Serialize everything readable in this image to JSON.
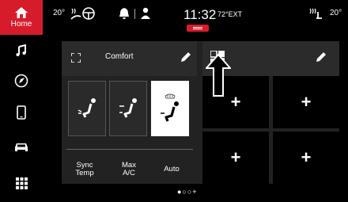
{
  "nav": {
    "home_label": "Home",
    "items": [
      "music-icon",
      "compass-icon",
      "phone-icon",
      "car-icon",
      "apps-grid-icon"
    ]
  },
  "status": {
    "left_temp": "20°",
    "right_temp": "20°",
    "clock": "11:32",
    "ext_temp": "72°EXT"
  },
  "climate": {
    "preset": "Comfort",
    "controls": [
      "Sync Temp",
      "Max A/C",
      "Auto"
    ]
  },
  "tiles": {
    "add_label": "+"
  },
  "pager": "●○○+",
  "colors": {
    "accent": "#d61c2b",
    "background": "#000000",
    "panel": "#222222"
  }
}
